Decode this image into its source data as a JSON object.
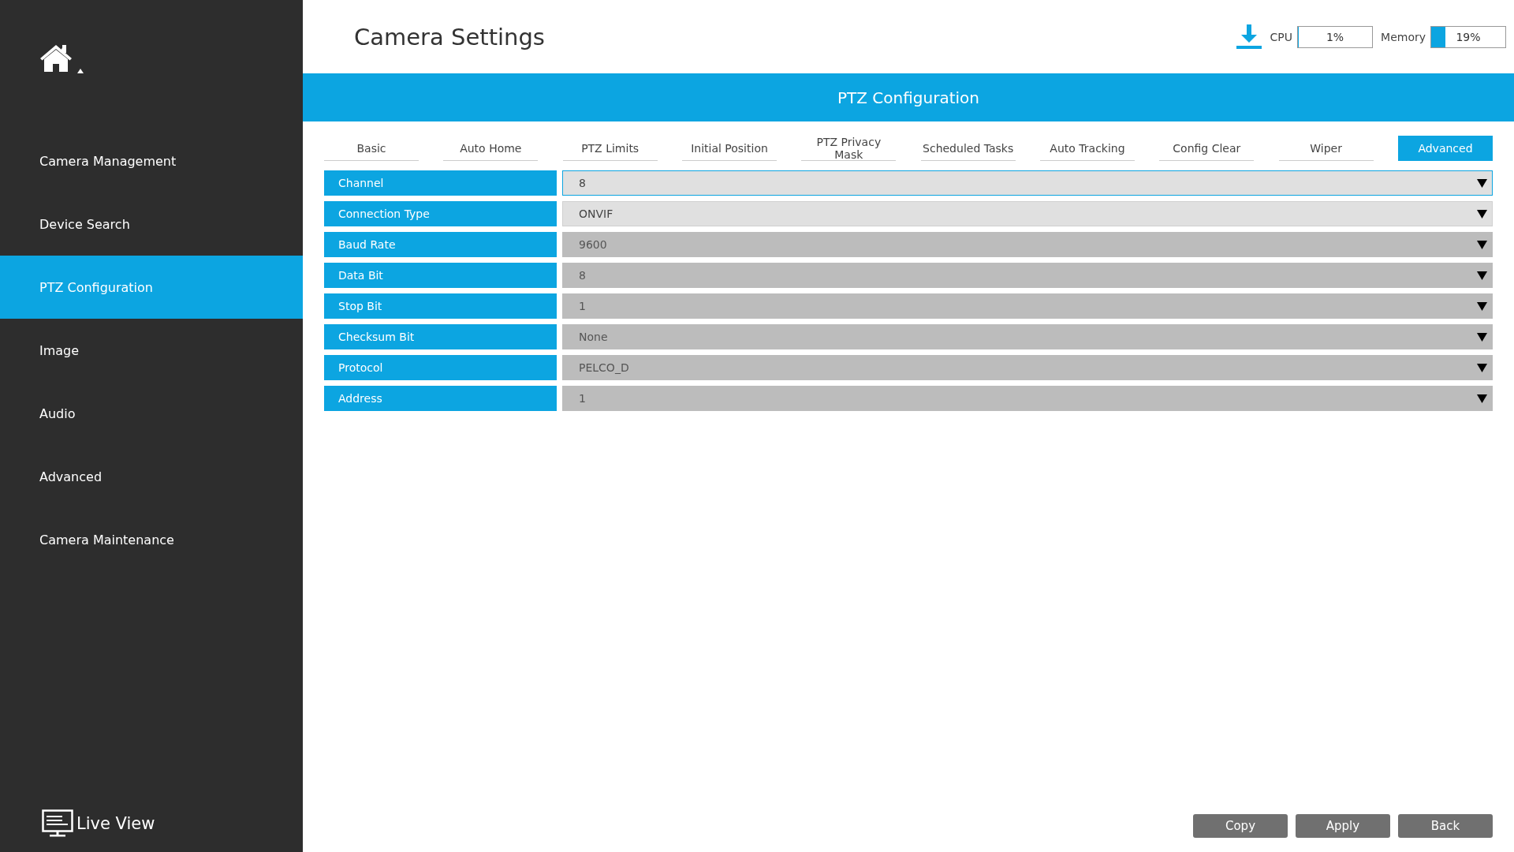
{
  "title": "Camera Settings",
  "sidebar": {
    "items": [
      {
        "label": "Camera Management",
        "selected": false
      },
      {
        "label": "Device Search",
        "selected": false
      },
      {
        "label": "PTZ Configuration",
        "selected": true
      },
      {
        "label": "Image",
        "selected": false
      },
      {
        "label": "Audio",
        "selected": false
      },
      {
        "label": "Advanced",
        "selected": false
      },
      {
        "label": "Camera Maintenance",
        "selected": false
      }
    ],
    "live_view": "Live View"
  },
  "stats": {
    "cpu": {
      "label": "CPU",
      "reading": "1%",
      "level": 0.01
    },
    "memory": {
      "label": "Memory",
      "reading": "19%",
      "level": 0.19
    }
  },
  "section_title": "PTZ Configuration",
  "tabs": [
    {
      "label": "Basic",
      "selected": false
    },
    {
      "label": "Auto Home",
      "selected": false
    },
    {
      "label": "PTZ Limits",
      "selected": false
    },
    {
      "label": "Initial Position",
      "selected": false
    },
    {
      "label": "PTZ Privacy Mask",
      "selected": false
    },
    {
      "label": "Scheduled Tasks",
      "selected": false
    },
    {
      "label": "Auto Tracking",
      "selected": false
    },
    {
      "label": "Config Clear",
      "selected": false
    },
    {
      "label": "Wiper",
      "selected": false
    },
    {
      "label": "Advanced",
      "selected": true
    }
  ],
  "fields": [
    {
      "label": "Channel",
      "value": "8",
      "disabled": false,
      "focused": true
    },
    {
      "label": "Connection Type",
      "value": "ONVIF",
      "disabled": false,
      "focused": false
    },
    {
      "label": "Baud Rate",
      "value": "9600",
      "disabled": true,
      "focused": false
    },
    {
      "label": "Data Bit",
      "value": "8",
      "disabled": true,
      "focused": false
    },
    {
      "label": "Stop Bit",
      "value": "1",
      "disabled": true,
      "focused": false
    },
    {
      "label": "Checksum Bit",
      "value": "None",
      "disabled": true,
      "focused": false
    },
    {
      "label": "Protocol",
      "value": "PELCO_D",
      "disabled": true,
      "focused": false
    },
    {
      "label": "Address",
      "value": "1",
      "disabled": true,
      "focused": false
    }
  ],
  "buttons": [
    "Copy",
    "Apply",
    "Back"
  ]
}
